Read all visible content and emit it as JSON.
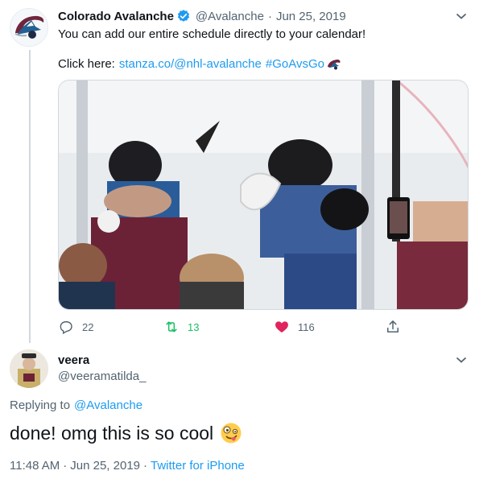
{
  "tweet": {
    "author_name": "Colorado Avalanche",
    "handle": "@Avalanche",
    "separator": "·",
    "date": "Jun 25, 2019",
    "text_line1": "You can add our entire schedule directly to your calendar!",
    "click_prefix": "Click here:",
    "link_text": "stanza.co/@nhl-avalanche",
    "hashtag": "#GoAvsGo",
    "reply_count": "22",
    "retweet_count": "13",
    "like_count": "116",
    "colors": {
      "retweet": "#17bf63",
      "like": "#e0245e",
      "link": "#1d9bf0",
      "verified": "#1d9bf0"
    },
    "icons": [
      "chevron-down-icon",
      "verified-badge-icon",
      "reply-icon",
      "retweet-icon",
      "heart-icon",
      "share-icon",
      "avs-logo-emoji"
    ]
  },
  "reply": {
    "author_name": "veera",
    "handle": "@veeramatilda_",
    "replying_prefix": "Replying to",
    "replying_handle": "@Avalanche",
    "text": "done! omg this is so cool",
    "emoji": "zany-face-emoji",
    "time": "11:48 AM",
    "separator": "·",
    "date": "Jun 25, 2019",
    "separator2": "·",
    "client": "Twitter for iPhone"
  }
}
